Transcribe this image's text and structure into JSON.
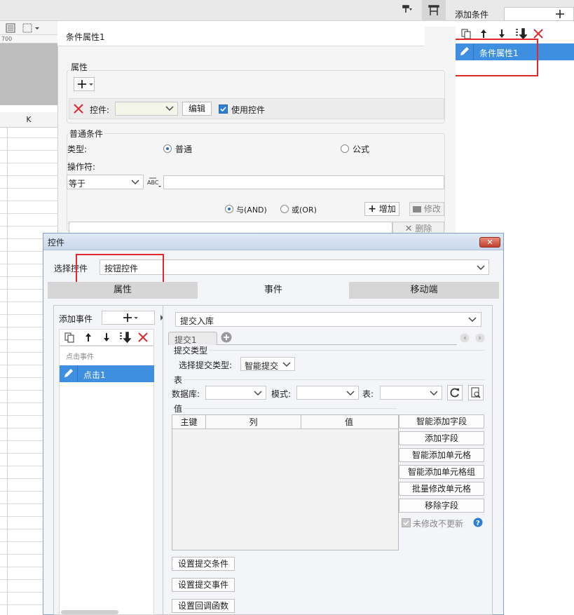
{
  "background": {
    "ruler_number": "700",
    "column_header": "K"
  },
  "right_panel": {
    "add_condition_label": "添加条件",
    "selected_item": "条件属性1"
  },
  "condition_panel": {
    "title": "条件属性1",
    "attributes_group": "属性",
    "widget_label": "控件:",
    "edit_button": "编辑",
    "use_widget_label": "使用控件",
    "normal_condition_group": "普通条件",
    "type_label": "类型:",
    "type_normal": "普通",
    "type_formula": "公式",
    "operator_label": "操作符:",
    "operator_value": "等于",
    "and_label": "与(AND)",
    "or_label": "或(OR)",
    "add_button": "增加",
    "modify_button": "修改",
    "delete_button": "删除"
  },
  "dialog": {
    "title": "控件",
    "select_widget_label": "选择控件",
    "select_widget_value": "按钮控件",
    "tabs": [
      "属性",
      "事件",
      "移动端"
    ],
    "add_event_label": "添加事件",
    "click_event_group": "点击事件",
    "event_item": "点击1",
    "submit_mode": "提交入库",
    "subtab": "提交1",
    "submit_type_group": "提交类型",
    "select_submit_type_label": "选择提交类型:",
    "submit_type_value": "智能提交",
    "table_group": "表",
    "database_label": "数据库:",
    "mode_label": "模式:",
    "table_label": "表:",
    "value_group": "值",
    "columns": [
      "主键",
      "列",
      "值"
    ],
    "side_buttons": [
      "智能添加字段",
      "添加字段",
      "智能添加单元格",
      "智能添加单元格组",
      "批量修改单元格",
      "移除字段"
    ],
    "no_update_label": "未修改不更新",
    "bottom_buttons": [
      "设置提交条件",
      "设置提交事件",
      "设置回调函数"
    ]
  },
  "colors": {
    "selection": "#3e8fe0",
    "highlight": "#e0282f",
    "delete_red": "#e0282f"
  }
}
